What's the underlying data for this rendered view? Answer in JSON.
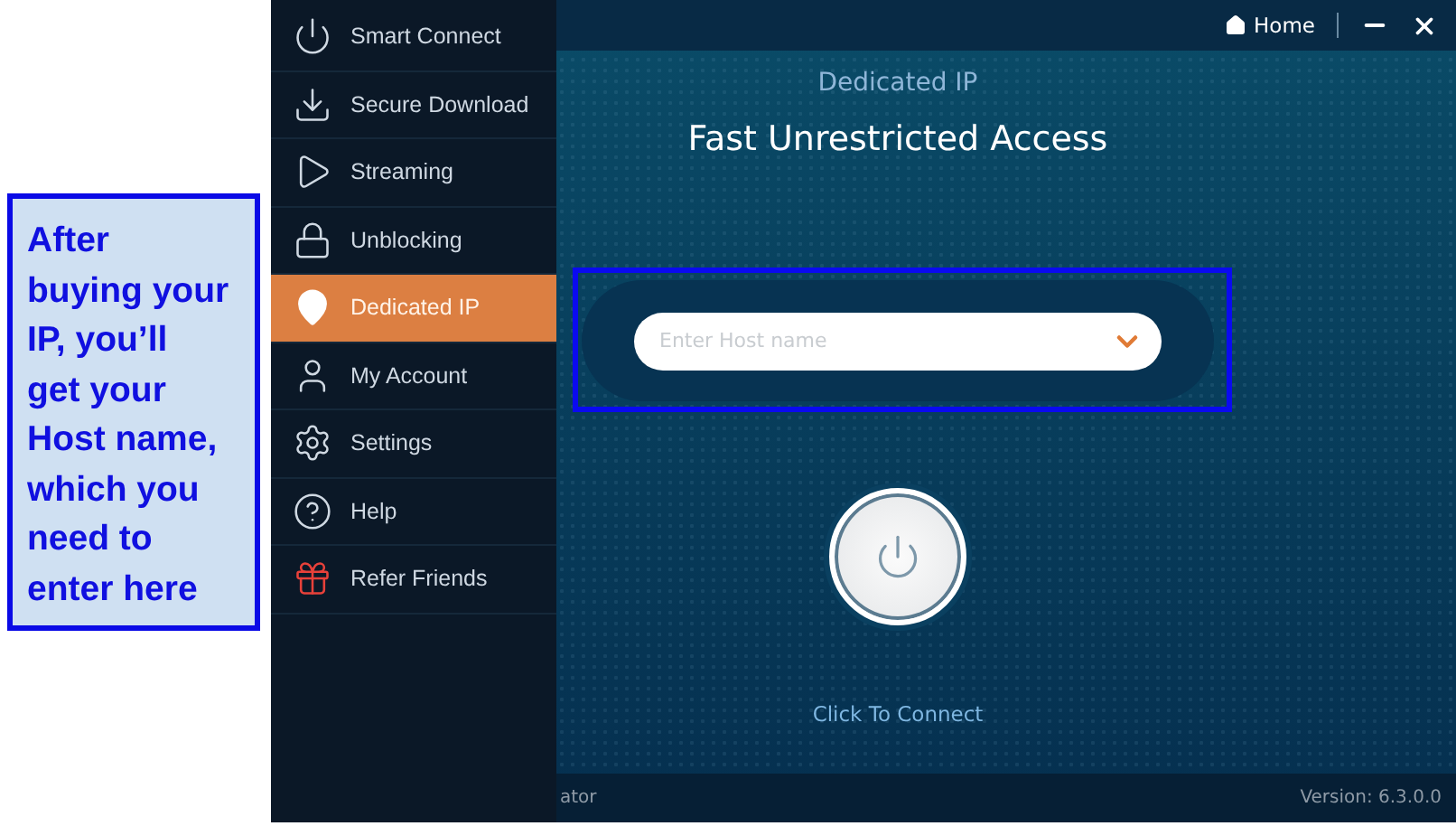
{
  "callout": {
    "text": "After buying your IP, you’ll get your Host name, which you need to enter here"
  },
  "sidebar": {
    "items": [
      {
        "label": "Smart Connect",
        "selected": false
      },
      {
        "label": "Secure Download",
        "selected": false
      },
      {
        "label": "Streaming",
        "selected": false
      },
      {
        "label": "Unblocking",
        "selected": false
      },
      {
        "label": "Dedicated IP",
        "selected": true
      },
      {
        "label": "My Account",
        "selected": false
      },
      {
        "label": "Settings",
        "selected": false
      },
      {
        "label": "Help",
        "selected": false
      },
      {
        "label": "Refer Friends",
        "selected": false
      }
    ]
  },
  "title_bar": {
    "home_label": "Home"
  },
  "main": {
    "subtitle": "Dedicated IP",
    "title": "Fast Unrestricted Access",
    "host_field": {
      "placeholder": "Enter Host name"
    },
    "connect_label": "Click To Connect"
  },
  "status_bar": {
    "left": "ator",
    "version": "Version:  6.3.0.0"
  }
}
